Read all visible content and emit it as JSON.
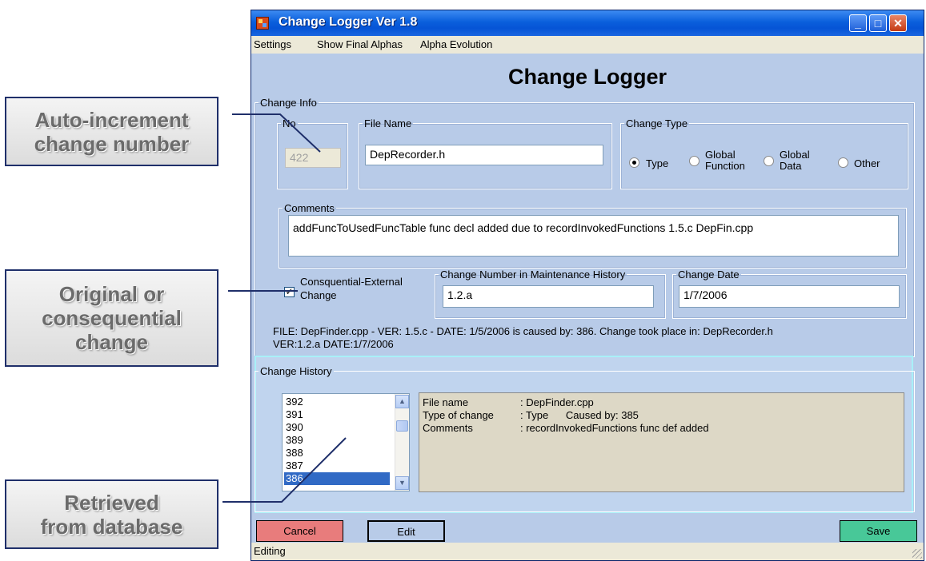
{
  "window": {
    "title": "Change Logger Ver 1.8",
    "minimize_label": "_",
    "maximize_label": "□",
    "close_label": "✕"
  },
  "menu": [
    "Settings",
    "Show Final Alphas",
    "Alpha Evolution"
  ],
  "heading": "Change Logger",
  "change_info": {
    "legend": "Change Info",
    "no": {
      "legend": "No",
      "value": "422"
    },
    "file_name": {
      "legend": "File Name",
      "value": "DepRecorder.h"
    },
    "change_type": {
      "legend": "Change Type",
      "options": [
        {
          "label": "Type",
          "selected": true
        },
        {
          "label": "Global Function",
          "line1": "Global",
          "line2": "Function",
          "selected": false
        },
        {
          "label": "Global Data",
          "line1": "Global",
          "line2": "Data",
          "selected": false
        },
        {
          "label": "Other",
          "selected": false
        }
      ]
    },
    "comments": {
      "legend": "Comments",
      "value": "addFuncToUsedFuncTable func decl added due to recordInvokedFunctions 1.5.c DepFin.cpp"
    },
    "consequential": {
      "label_line1": "Consquential-External",
      "label_line2": "Change",
      "checked": true,
      "check_mark": "✓"
    },
    "maint_history": {
      "legend": "Change Number in Maintenance History",
      "value": "1.2.a"
    },
    "change_date": {
      "legend": "Change Date",
      "value": "1/7/2006"
    },
    "summary_line1": "FILE: DepFinder.cpp - VER: 1.5.c - DATE: 1/5/2006 is caused by: 386. Change took place in: DepRecorder.h",
    "summary_line2": "VER:1.2.a DATE:1/7/2006"
  },
  "change_history": {
    "legend": "Change History",
    "items": [
      "392",
      "391",
      "390",
      "389",
      "388",
      "387",
      "386"
    ],
    "selected": "386",
    "scroll_up": "▲",
    "scroll_down": "▼",
    "details": [
      {
        "key": "File name",
        "value": ": DepFinder.cpp"
      },
      {
        "key": "Type of change",
        "value": ": Type      Caused by: 385"
      },
      {
        "key": "Comments",
        "value": ": recordInvokedFunctions func def added"
      }
    ]
  },
  "buttons": {
    "cancel": "Cancel",
    "edit": "Edit",
    "save": "Save"
  },
  "status": "Editing",
  "callouts": {
    "auto_increment": "Auto-increment change number",
    "original_consequential": "Original or consequential change",
    "retrieved": "Retrieved from database"
  },
  "colors": {
    "window_bg": "#b8cbe8",
    "cancel_bg": "#e87c7c",
    "edit_bg": "#b8cbe8",
    "save_bg": "#48c898",
    "selection": "#316ac5"
  }
}
